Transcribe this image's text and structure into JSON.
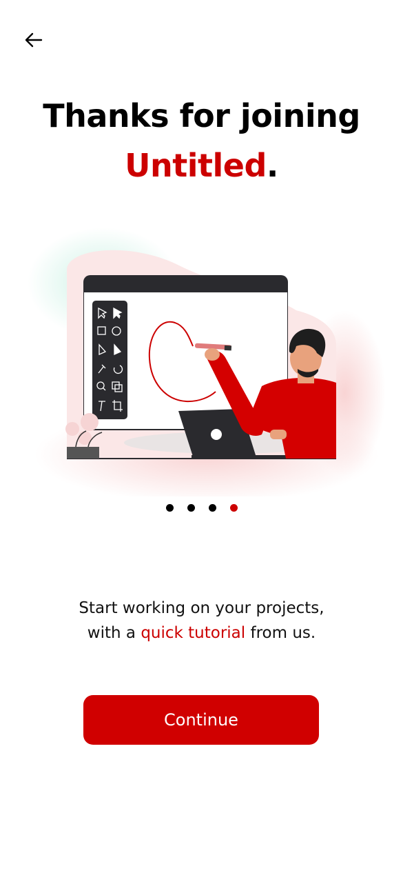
{
  "header": {
    "back_icon": "arrow-left-icon"
  },
  "title": {
    "line1": "Thanks for joining",
    "brand": "Untitled",
    "period": "."
  },
  "illustration": {
    "description_icon": "designer-whiteboard-illustration"
  },
  "pagination": {
    "total": 4,
    "active_index": 3
  },
  "subtitle": {
    "line1": "Start working on your projects,",
    "line2_prefix": "with a ",
    "line2_highlight": "quick tutorial",
    "line2_suffix": " from us."
  },
  "cta": {
    "label": "Continue"
  },
  "colors": {
    "brand": "#cc0000",
    "button": "#d00000",
    "text": "#000000"
  }
}
